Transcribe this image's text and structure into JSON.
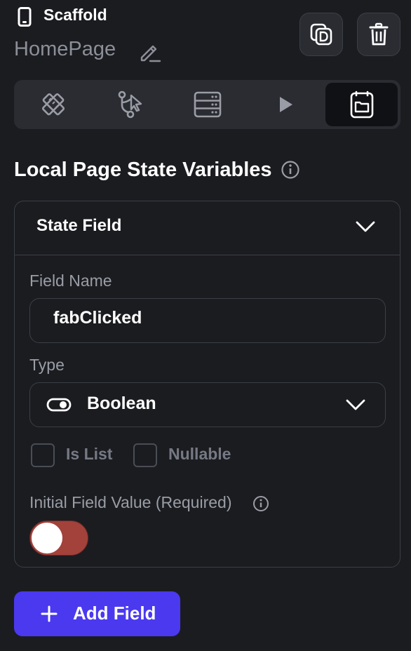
{
  "header": {
    "widget_icon": "phone-icon",
    "widget_type": "Scaffold",
    "page_name": "HomePage",
    "edit_icon": "pencil-icon",
    "duplicate_icon": "duplicate-icon",
    "delete_icon": "trash-icon"
  },
  "tabs": [
    {
      "icon": "design-tools-icon",
      "active": false
    },
    {
      "icon": "actions-flow-icon",
      "active": false
    },
    {
      "icon": "backend-query-icon",
      "active": false
    },
    {
      "icon": "play-icon",
      "active": false
    },
    {
      "icon": "page-state-icon",
      "active": true
    }
  ],
  "section": {
    "title": "Local Page State Variables",
    "info_icon": "info-icon"
  },
  "state_field": {
    "header": "State Field",
    "field_name_label": "Field Name",
    "field_name_value": "fabClicked",
    "type_label": "Type",
    "type_value": "Boolean",
    "type_icon": "toggle-icon",
    "is_list_label": "Is List",
    "is_list_checked": false,
    "nullable_label": "Nullable",
    "nullable_checked": false,
    "initial_value_label": "Initial Field Value (Required)",
    "initial_value": false
  },
  "add_button": {
    "label": "Add Field",
    "icon": "plus-icon"
  },
  "colors": {
    "background": "#1b1c20",
    "panel": "#2a2c32",
    "border": "#3c3f47",
    "accent": "#4b39ef",
    "switch_off": "#a3413b"
  }
}
